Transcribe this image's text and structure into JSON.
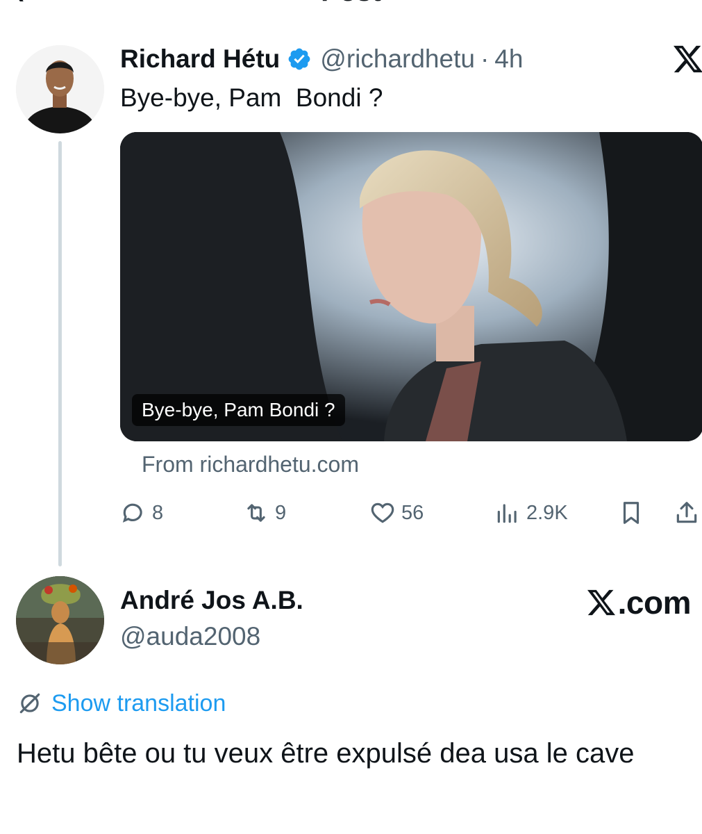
{
  "header": {
    "title": "Post",
    "back_icon": "back-arrow-icon"
  },
  "tweet": {
    "author_name": "Richard Hétu",
    "verified": true,
    "handle": "@richardhetu",
    "separator": "·",
    "time": "4h",
    "text": "Bye-bye, Pam  Bondi ?",
    "media_caption": "Bye-bye, Pam Bondi ?",
    "source": "From richardhetu.com",
    "stats": {
      "replies": "8",
      "reposts": "9",
      "likes": "56",
      "views": "2.9K"
    }
  },
  "reply": {
    "author_name": "André Jos A.B.",
    "handle": "@auda2008",
    "brand": ".com",
    "translate_label": "Show translation",
    "text": "Hetu bête ou tu veux être expulsé dea usa  le cave"
  },
  "colors": {
    "text": "#0f1419",
    "secondary": "#536471",
    "link": "#1d9bf0",
    "verified": "#1d9bf0",
    "thread_line": "#cfd9de"
  }
}
